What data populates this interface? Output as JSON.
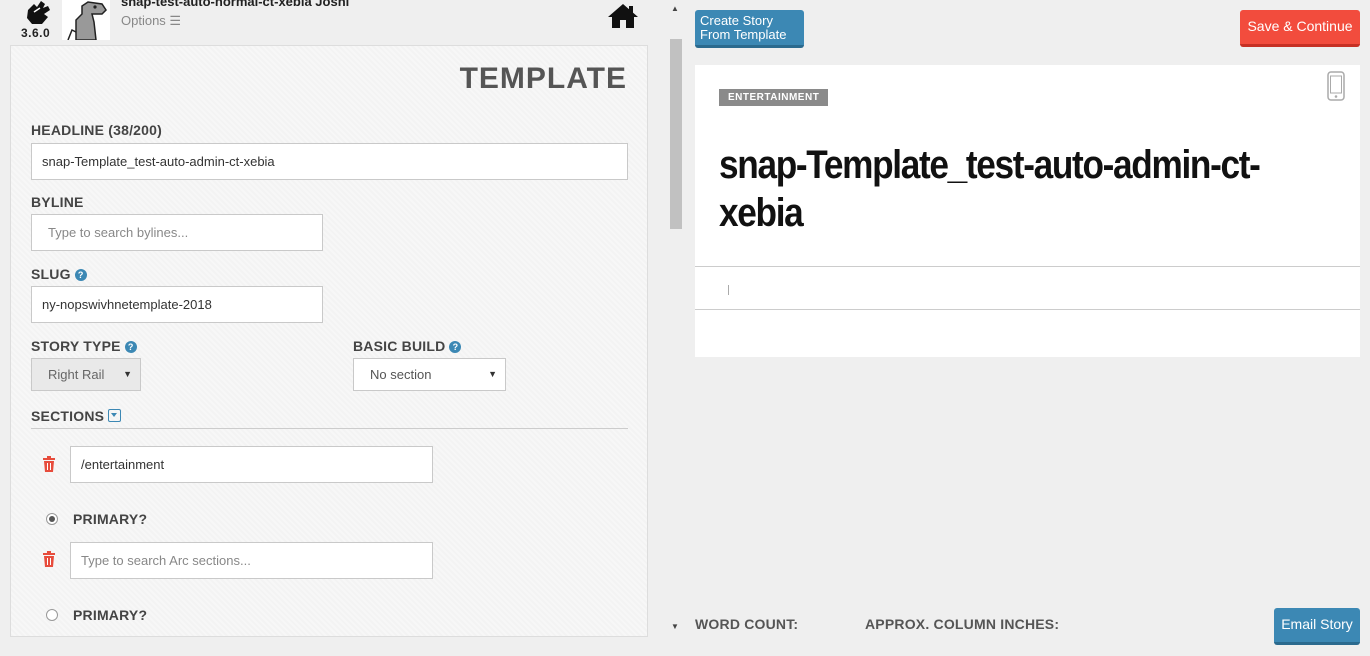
{
  "header": {
    "version": "3.6.0",
    "story_title": "snap-test-auto-normal-ct-xebia Joshi",
    "options_label": "Options ☰"
  },
  "form": {
    "title": "TEMPLATE",
    "headline_label": "HEADLINE (38/200)",
    "headline_value": "snap-Template_test-auto-admin-ct-xebia",
    "byline_label": "BYLINE",
    "byline_placeholder": "Type to search bylines...",
    "slug_label": "SLUG",
    "slug_value": "ny-nopswivhnetemplate-2018",
    "story_type_label": "STORY TYPE",
    "story_type_value": "Right Rail",
    "basic_build_label": "BASIC BUILD",
    "basic_build_value": "No section",
    "sections_label": "SECTIONS",
    "sections": [
      {
        "value": "/entertainment",
        "placeholder": "",
        "primary_label": "PRIMARY?",
        "primary": true
      },
      {
        "value": "",
        "placeholder": "Type to search Arc sections...",
        "primary_label": "PRIMARY?",
        "primary": false
      }
    ]
  },
  "toolbar": {
    "create_from_template": "Create Story From Template",
    "save_continue": "Save & Continue"
  },
  "preview": {
    "tag": "ENTERTAINMENT",
    "headline": "snap-Template_test-auto-admin-ct-xebia"
  },
  "footer": {
    "word_count_label": "WORD COUNT:",
    "column_inches_label": "APPROX. COLUMN INCHES:",
    "email_story": "Email Story"
  },
  "colors": {
    "accent_blue": "#3c88b4",
    "save_red": "#f24c3d"
  }
}
